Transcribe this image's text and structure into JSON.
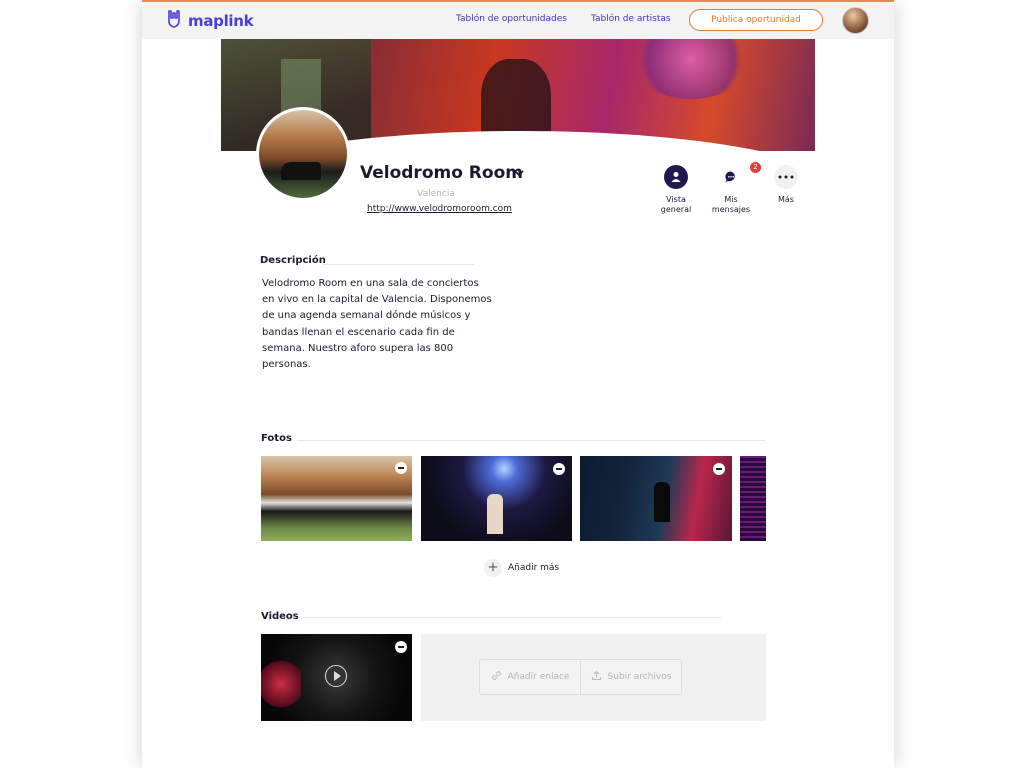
{
  "header": {
    "logo": "maplink",
    "nav": [
      "Tablón de oportunidades",
      "Tablón de artistas"
    ],
    "publish_button": "Publica oportunidad"
  },
  "profile": {
    "name": "Velodromo Room",
    "city": "Valencia",
    "url": "http://www.velodromoroom.com"
  },
  "actions": [
    {
      "label_line1": "Vista",
      "label_line2": "general",
      "icon": "user-icon"
    },
    {
      "label_line1": "Mis",
      "label_line2": "mensajes",
      "icon": "chat-icon",
      "badge": "2"
    },
    {
      "label_line1": "Más",
      "label_line2": "",
      "icon": "more-dots-icon"
    }
  ],
  "description": {
    "title": "Descripción",
    "text": "Velodromo Room en una sala de conciertos en vivo en la capital de Valencia. Disponemos de una agenda semanal dónde músicos y bandas llenan el escenario cada fin de semana. Nuestro aforo supera las 800 personas."
  },
  "photos": {
    "title": "Fotos",
    "add_more": "Añadir más"
  },
  "videos": {
    "title": "Videos",
    "add_link": "Añadir enlace",
    "upload": "Subir archivos"
  },
  "colors": {
    "brand": "#4a3fd8",
    "accent": "#e57a30",
    "dark": "#1f1a4f",
    "badge": "#e63b3b"
  }
}
